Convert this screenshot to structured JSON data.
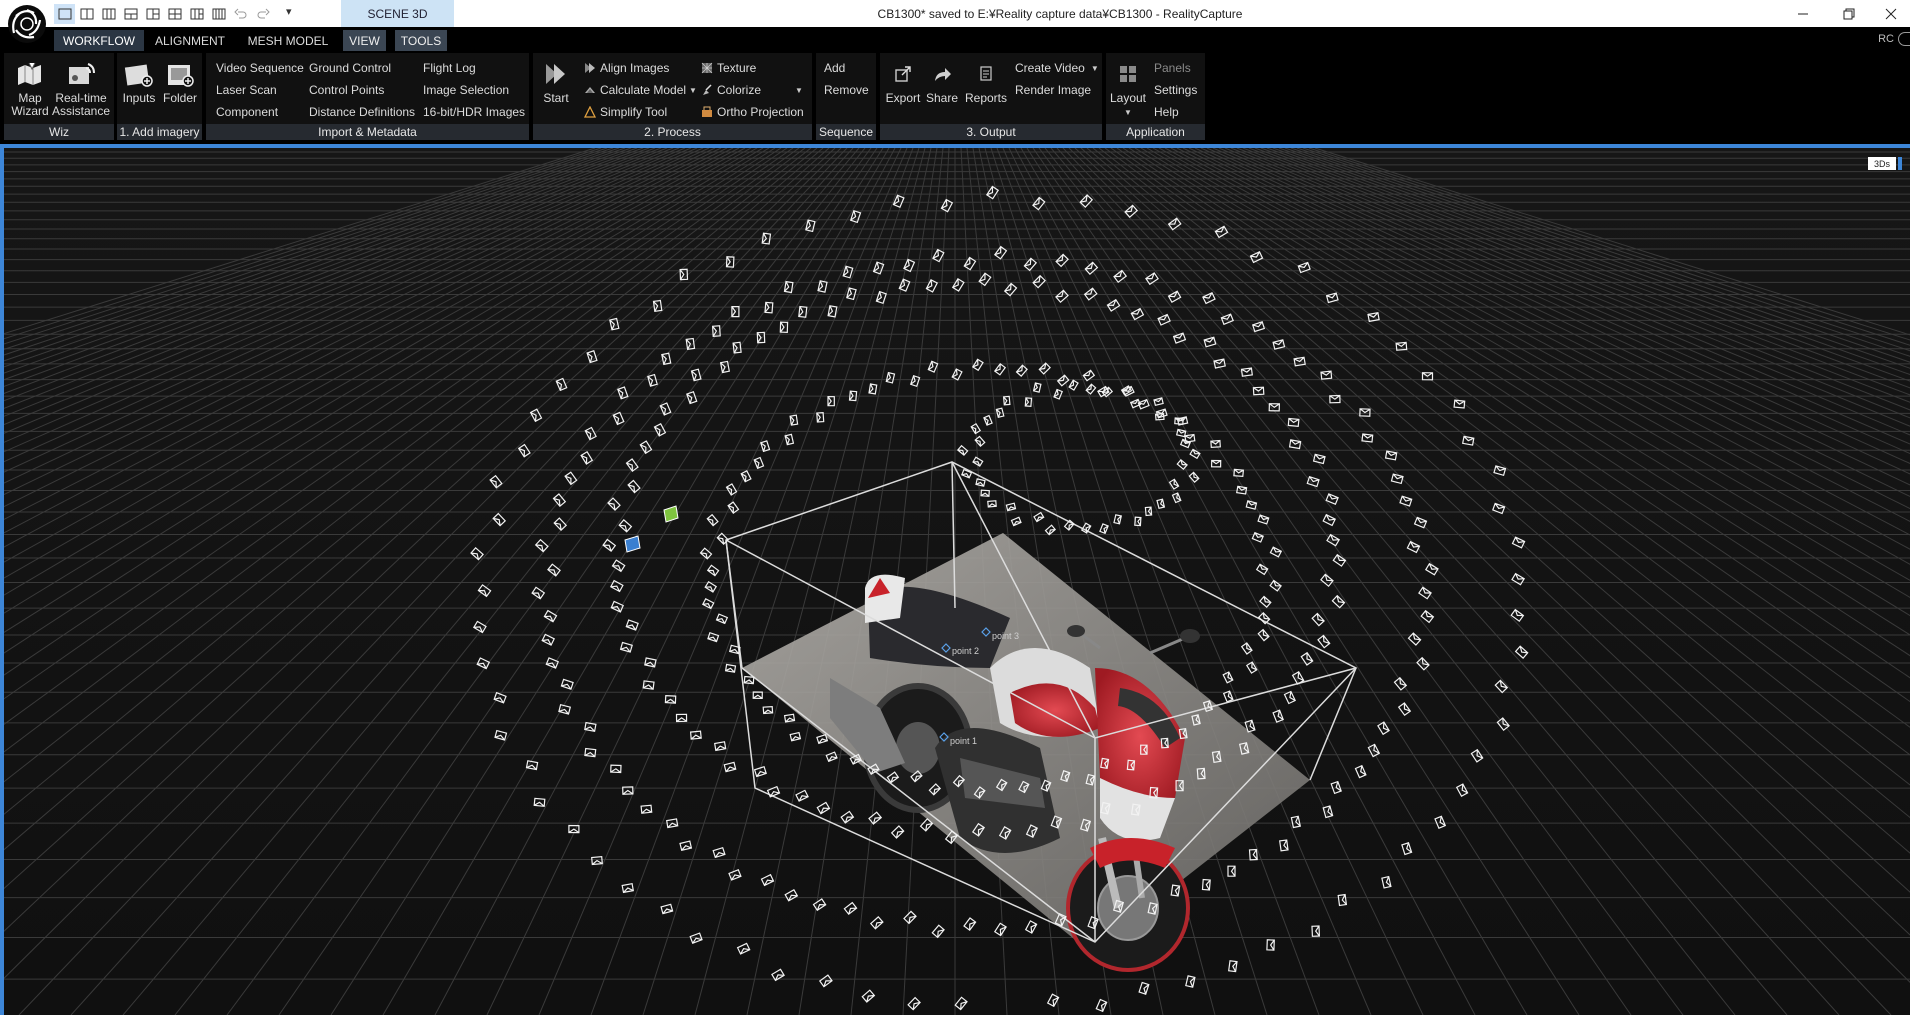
{
  "titlebar": {
    "scene_tab": "SCENE 3D",
    "window_title": "CB1300* saved to E:¥Reality capture data¥CB1300 - RealityCapture",
    "quick_access": [
      "layout-1-icon",
      "layout-2-icon",
      "layout-3-icon",
      "layout-4-icon",
      "layout-5-icon",
      "layout-6-icon",
      "layout-7-icon",
      "layout-8-icon",
      "undo-icon",
      "redo-icon"
    ],
    "dropdown_glyph": "▾"
  },
  "menu": {
    "tabs": [
      "WORKFLOW",
      "ALIGNMENT",
      "MESH MODEL",
      "VIEW",
      "TOOLS"
    ],
    "right_label": "RC"
  },
  "ribbon": {
    "wiz": {
      "label": "Wiz",
      "map_wizard": "Map\nWizard",
      "realtime": "Real-time\nAssistance"
    },
    "add_imagery": {
      "label": "1. Add imagery",
      "inputs": "Inputs",
      "folder": "Folder"
    },
    "import": {
      "label": "Import & Metadata",
      "items": [
        "Video Sequence",
        "Laser Scan",
        "Component",
        "Ground Control",
        "Control Points",
        "Distance Definitions",
        "Flight Log",
        "Image Selection",
        "16-bit/HDR Images"
      ]
    },
    "process": {
      "label": "2. Process",
      "start": "Start",
      "align": "Align Images",
      "calculate": "Calculate Model",
      "simplify": "Simplify Tool",
      "texture": "Texture",
      "colorize": "Colorize",
      "ortho": "Ortho Projection"
    },
    "sequence": {
      "label": "Sequence",
      "add": "Add",
      "remove": "Remove"
    },
    "output": {
      "label": "3. Output",
      "export": "Export",
      "share": "Share",
      "reports": "Reports",
      "create_video": "Create Video",
      "render_image": "Render Image"
    },
    "application": {
      "label": "Application",
      "layout": "Layout",
      "panels": "Panels",
      "settings": "Settings",
      "help": "Help"
    }
  },
  "viewport": {
    "badge": "3Ds",
    "points": [
      "point 1",
      "point 2",
      "point 3"
    ],
    "accent": "#3d86d8"
  }
}
